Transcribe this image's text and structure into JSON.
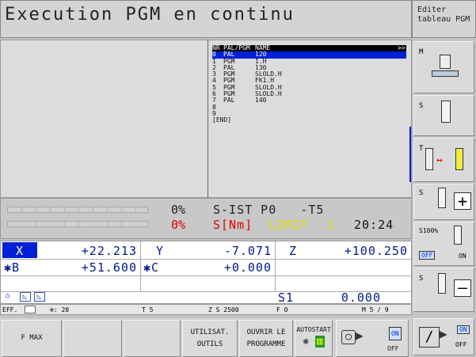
{
  "header": {
    "title": "Execution PGM en continu",
    "mode_line1": "Editer",
    "mode_line2": "tableau PGM"
  },
  "table": {
    "headers": [
      "NR",
      "PAL/PGM",
      "NAME",
      ">>"
    ],
    "rows": [
      {
        "nr": "0",
        "type": "PAL",
        "name": "120"
      },
      {
        "nr": "1",
        "type": "PGM",
        "name": "1.H"
      },
      {
        "nr": "2",
        "type": "PAL",
        "name": "130"
      },
      {
        "nr": "3",
        "type": "PGM",
        "name": "SLOLD.H"
      },
      {
        "nr": "4",
        "type": "PGM",
        "name": "FK1.H"
      },
      {
        "nr": "5",
        "type": "PGM",
        "name": "SLOLD.H"
      },
      {
        "nr": "6",
        "type": "PGM",
        "name": "SLOLD.H"
      },
      {
        "nr": "7",
        "type": "PAL",
        "name": "140"
      },
      {
        "nr": "8",
        "type": "",
        "name": ""
      },
      {
        "nr": "9",
        "type": "",
        "name": ""
      }
    ],
    "end_label": "[END]"
  },
  "status": {
    "pct1": "0%",
    "pct2": "0%",
    "line1": "S-IST P0   -T5",
    "line2_a": "S[Nm]",
    "line2_b": "LIMIT",
    "line2_c": "1",
    "time": "20:24"
  },
  "positions": {
    "x_label": "X",
    "x_val": "+22.213",
    "y_label": "Y",
    "y_val": "-7.071",
    "z_label": "Z",
    "z_val": "+100.250",
    "b_label": "✱B",
    "b_val": "+51.600",
    "c_label": "✱C",
    "c_val": "+0.000",
    "s1_label": "S1",
    "s1_val": "0.000"
  },
  "info": {
    "eff": "EFF.",
    "feed_icon_value": "⊕: 20",
    "t": "T 5",
    "zs": "Z S 2500",
    "f": "F 0",
    "m": "M 5 / 9"
  },
  "softkeys": {
    "f_max": "F MAX",
    "utilisat_1": "UTILISAT.",
    "utilisat_2": "OUTILS",
    "ouvrir_1": "OUVRIR LE",
    "ouvrir_2": "PROGRAMME",
    "autostart": "AUTOSTART",
    "on1": "ON",
    "off1": "OFF",
    "on2": "ON",
    "off2": "OFF"
  },
  "right_keys": {
    "m_label": "M",
    "s_label": "S",
    "t_label": "T",
    "s100": "S100%",
    "off": "OFF",
    "on": "ON"
  },
  "colors": {
    "selection": "#0020d8",
    "red": "#e00000",
    "yellow": "#e8e000",
    "blue_text": "#001a8a"
  }
}
